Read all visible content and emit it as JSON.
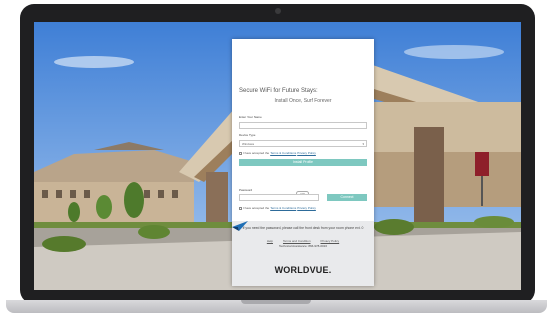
{
  "portal": {
    "heading": "Secure WiFi for Future Stays:",
    "subheading": "Install Once, Surf Forever",
    "name_label": "Enter Your Name",
    "device_label": "Device Type",
    "device_value": "Windows",
    "terms_prefix": "I have accepted the",
    "terms_link": "Terms & Conditions",
    "privacy_link": "Privacy Policy",
    "install_button": "Install Profile",
    "or_label": "OR",
    "password_label": "Password",
    "connect_button": "Connect",
    "footnote": "If you need the password, please call the front desk from your room phone ext. 0",
    "footer_links": [
      "Help",
      "Terms and Condition",
      "Privacy Policy"
    ],
    "tech_support": "Technical Assistance: 866-978-0016",
    "brand": "WORLDVUE."
  },
  "colors": {
    "accent_button": "#7ec8c0",
    "footer_bg": "#e9eaec",
    "logo_blue": "#1f6fb5"
  }
}
